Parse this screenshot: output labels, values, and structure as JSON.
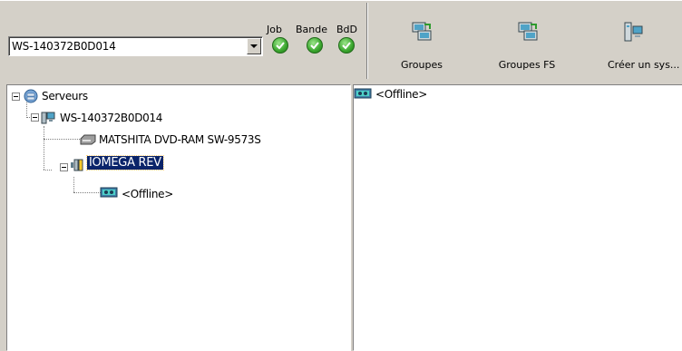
{
  "toolbar": {
    "server_select": {
      "value": "WS-140372B0D014"
    },
    "status": [
      {
        "label": "Job",
        "icon": "check-circle-icon"
      },
      {
        "label": "Bande",
        "icon": "check-circle-icon"
      },
      {
        "label": "BdD",
        "icon": "check-circle-icon"
      }
    ],
    "buttons": [
      {
        "label": "Groupes",
        "icon": "groups-icon"
      },
      {
        "label": "Groupes FS",
        "icon": "fs-groups-icon"
      },
      {
        "label": "Créer un sys...",
        "icon": "create-system-icon"
      }
    ]
  },
  "tree": {
    "root": {
      "label": "Serveurs",
      "icon": "servers-icon"
    },
    "server": {
      "label": "WS-140372B0D014",
      "icon": "computer-icon"
    },
    "drive": {
      "label": "MATSHITA DVD-RAM SW-9573S",
      "icon": "dvd-drive-icon"
    },
    "device": {
      "label": "IOMEGA REV",
      "icon": "rev-drive-icon"
    },
    "media": {
      "label": "<Offline>",
      "icon": "tape-icon"
    }
  },
  "detail": {
    "items": [
      {
        "label": "<Offline>",
        "icon": "tape-icon"
      }
    ]
  },
  "colors": {
    "selection": "#0a246a",
    "status_ok": "#3aa62e",
    "chrome": "#d4d0c8"
  }
}
